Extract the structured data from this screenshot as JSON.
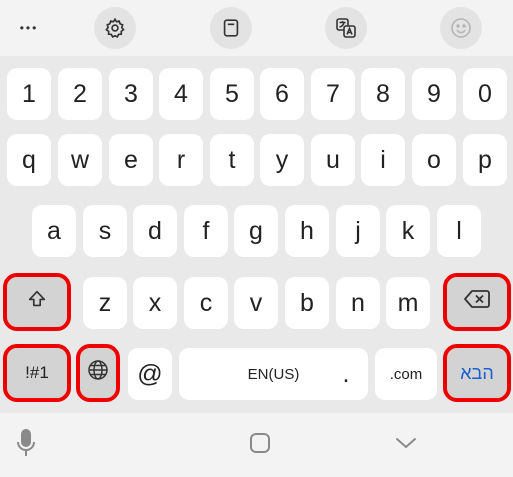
{
  "toolbar": {
    "more_label": "•••",
    "icons": [
      "more-icon",
      "settings-icon",
      "clipboard-icon",
      "translate-icon",
      "emoji-icon"
    ]
  },
  "keyboard": {
    "row_numbers": [
      "1",
      "2",
      "3",
      "4",
      "5",
      "6",
      "7",
      "8",
      "9",
      "0"
    ],
    "row_top": [
      "q",
      "w",
      "e",
      "r",
      "t",
      "y",
      "u",
      "i",
      "o",
      "p"
    ],
    "row_home": [
      "a",
      "s",
      "d",
      "f",
      "g",
      "h",
      "j",
      "k",
      "l"
    ],
    "row_bottom": [
      "z",
      "x",
      "c",
      "v",
      "b",
      "n",
      "m"
    ],
    "symbols_label": "!#1",
    "at_label": "@",
    "space_label": "EN(US)",
    "period_label": ".",
    "dotcom_label": ".com",
    "enter_label": "הבא"
  },
  "colors": {
    "highlight": "#ee0000",
    "enter_text": "#1a5fd0",
    "key_bg": "#ffffff",
    "func_key_bg": "#d3d3d3"
  },
  "navbar": {
    "icons": [
      "microphone-icon",
      "home-icon",
      "hide-keyboard-icon"
    ]
  }
}
